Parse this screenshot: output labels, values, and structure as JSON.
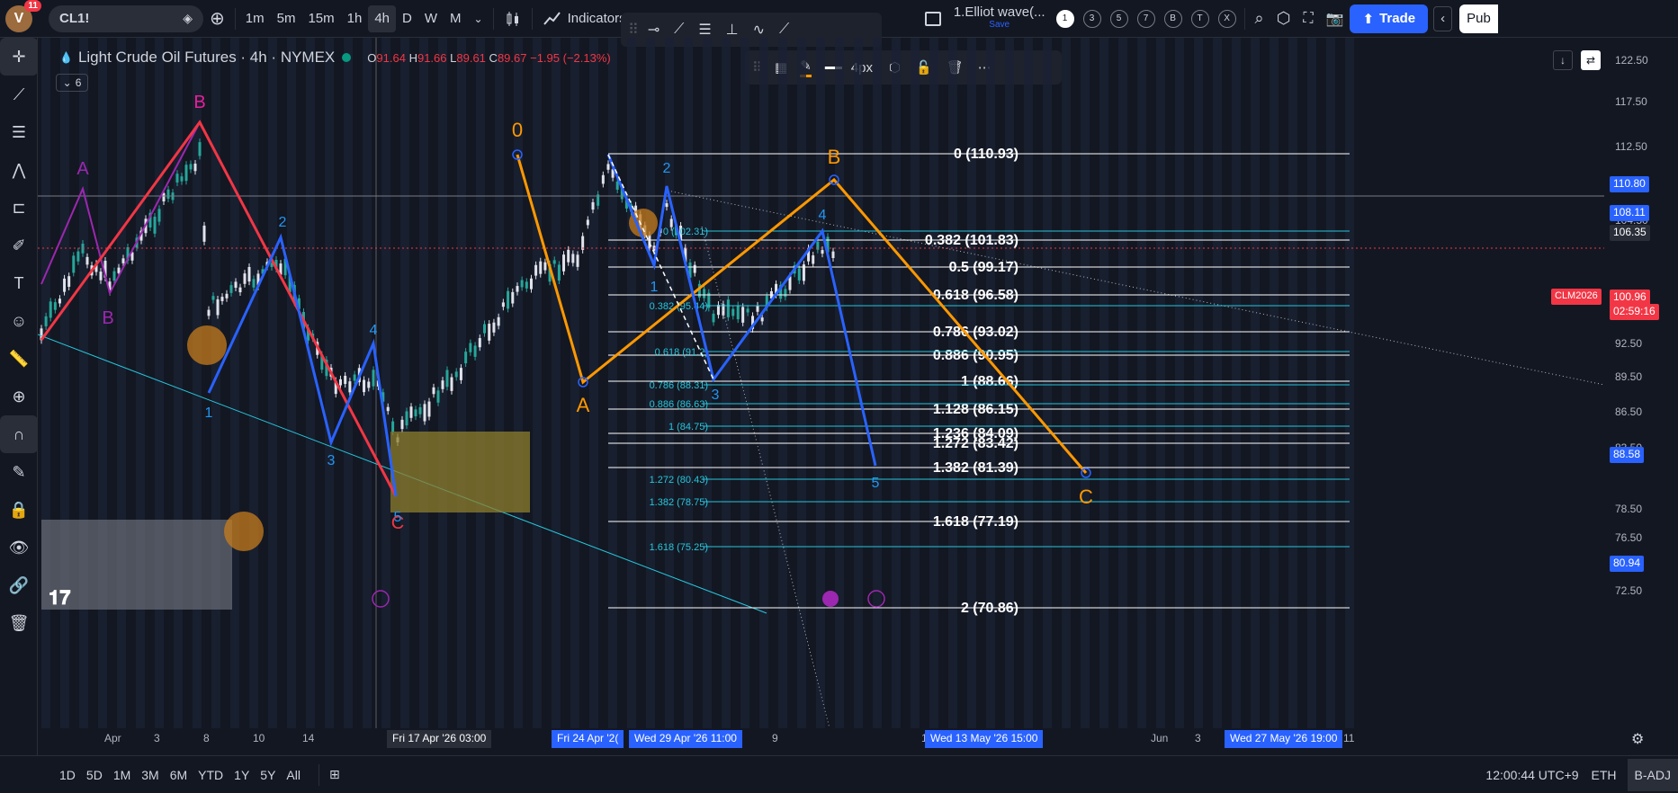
{
  "topbar": {
    "avatar_letter": "V",
    "notif_count": "11",
    "symbol": "CL1!",
    "timeframes": [
      "1m",
      "5m",
      "15m",
      "1h",
      "4h",
      "D",
      "W",
      "M"
    ],
    "active_timeframe": "4h",
    "indicators_label": "Indicators",
    "layout_name": "1.Elliot wave(...",
    "layout_save": "Save",
    "wave_numbers": [
      "1",
      "3",
      "5",
      "7",
      "B",
      "T",
      "X"
    ],
    "trade_label": "Trade",
    "publish_label": "Pub"
  },
  "legend": {
    "title": "Light Crude Oil Futures · 4h · NYMEX",
    "o_label": "O",
    "o_val": "91.64",
    "h_label": "H",
    "h_val": "91.66",
    "l_label": "L",
    "l_val": "89.61",
    "c_label": "C",
    "c_val": "89.67",
    "change": "−1.95 (−2.13%)",
    "indicator_count": "6"
  },
  "draw_toolbar": {
    "width_label": "4px"
  },
  "price_axis": {
    "ticks": [
      "122.50",
      "117.50",
      "112.50",
      "104.50",
      "96.50",
      "92.50",
      "89.50",
      "86.50",
      "83.50",
      "78.50",
      "76.50",
      "74.50",
      "72.50"
    ],
    "labels": [
      {
        "text": "110.80",
        "bg": "#2962ff"
      },
      {
        "text": "108.11",
        "bg": "#2962ff"
      },
      {
        "text": "106.35",
        "bg": "#2a2e39"
      },
      {
        "text": "100.96",
        "bg": "#f23645"
      },
      {
        "text": "02:59:16",
        "bg": "#f23645"
      },
      {
        "text": "88.58",
        "bg": "#2962ff"
      },
      {
        "text": "80.94",
        "bg": "#2962ff"
      }
    ],
    "symbol_tag": "CLM2026"
  },
  "fib_main": [
    {
      "label": "0 (110.93)"
    },
    {
      "label": "0.382 (101.83)"
    },
    {
      "label": "0.5 (99.17)"
    },
    {
      "label": "0.618 (96.58)"
    },
    {
      "label": "0.786 (93.02)"
    },
    {
      "label": "0.886 (90.95)"
    },
    {
      "label": "1 (88.66)"
    },
    {
      "label": "1.128 (86.15)"
    },
    {
      "label": "1.236 (84.09)"
    },
    {
      "label": "1.272 (83.42)"
    },
    {
      "label": "1.382 (81.39)"
    },
    {
      "label": "1.618 (77.19)"
    },
    {
      "label": "2 (70.86)"
    }
  ],
  "fib_small": [
    {
      "label": "0 (102.31)"
    },
    {
      "label": "0.382 (95.44)"
    },
    {
      "label": "0.618 (91.2)"
    },
    {
      "label": "0.786 (88.31)"
    },
    {
      "label": "0.886 (86.63)"
    },
    {
      "label": "1 (84.75)"
    },
    {
      "label": "1.272 (80.43)"
    },
    {
      "label": "1.382 (78.75)"
    },
    {
      "label": "1.618 (75.25)"
    }
  ],
  "wave_labels": {
    "a_purple": "A",
    "b_purple": "B",
    "b_pink": "B",
    "c_red": "C",
    "w1_left": "1",
    "w2_left": "2",
    "w3_left": "3",
    "w4_left": "4",
    "w5_left": "5",
    "zero_orange": "0",
    "a_orange": "A",
    "b_orange": "B",
    "c_orange": "C",
    "w1_right": "1",
    "w2_right": "2",
    "w3_right": "3",
    "w4_right": "4",
    "w5_right": "5"
  },
  "time_axis": {
    "ticks": [
      "Apr",
      "3",
      "8",
      "10",
      "14",
      "22",
      "5",
      "7",
      "9",
      "19",
      "21",
      "23",
      "Jun",
      "3",
      "5",
      "9",
      "11"
    ],
    "labels": [
      "Fri 17 Apr '26   03:00",
      "Fri 24 Apr '2(",
      "Wed 29 Apr '26   11:00",
      "Wed 13 May '26   15:00",
      "Wed 27 May '26   19:00"
    ]
  },
  "bottombar": {
    "ranges": [
      "1D",
      "5D",
      "1M",
      "3M",
      "6M",
      "YTD",
      "1Y",
      "5Y",
      "All"
    ],
    "clock": "12:00:44 UTC+9",
    "session": "ETH",
    "adj": "B-ADJ"
  }
}
